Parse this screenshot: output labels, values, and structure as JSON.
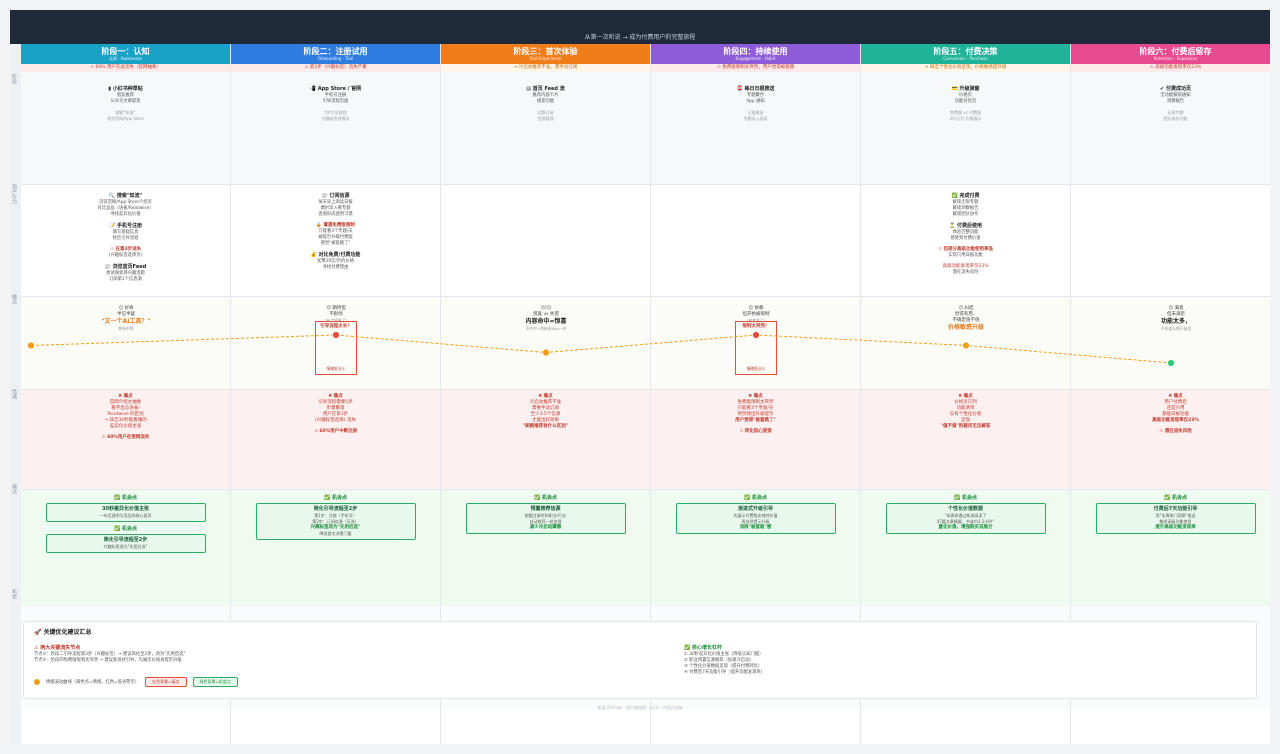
{
  "subtitle": "从第一次听说 → 成为付费用户的完整旅程",
  "gutter": [
    "阶段",
    "用户行为",
    "触点",
    "情绪",
    "痛点",
    "机会"
  ],
  "stages": [
    {
      "title": "阶段一：认知",
      "sub": "认知 · Awareness",
      "color": "#17a2c6",
      "warn": "⚠ 60% 用户在此流失（官网抽象）",
      "warn_bg": "#fdeaea",
      "touch": {
        "h": "▮ 小红书种草帖",
        "items": [
          "朋友推荐",
          "公众号文章提及"
        ],
        "grey": [
          "搜索\"知流\"",
          "浏览官网/App Store"
        ]
      },
      "actions": [
        {
          "h": "🔍 搜索\"知流\"",
          "items": [
            "浏览官网/App Store介绍页",
            "对比竞品（语雀/Readwise）",
            "寻找差异化价值"
          ]
        },
        {
          "h": "📝 手机号注册",
          "items": [
            "填写基础信息",
            "经历引导流程"
          ]
        },
        {
          "r": "⚠ 在第3步流失",
          "items": [
            "(兴趣标签选择页)"
          ]
        },
        {
          "h": "📰 浏览首页Feed",
          "items": [
            "尝试搜索感兴趣话题",
            "订阅第1个信息源"
          ]
        }
      ],
      "emotion": {
        "emo": "😐 好奇",
        "sub": "半信半疑",
        "quote": "\"又一个AI工具？\"",
        "small": "期待中等"
      },
      "pain": {
        "h": "✖ 痛点",
        "items": [
          "官网介绍太抽象",
          "看不出与语雀/",
          "Readwise 的区别",
          "→ 缺乏30秒能看懂的",
          "差异化价值主张"
        ],
        "stat": "⚠ 60%用户在官网流失"
      },
      "opps": [
        {
          "t": "30秒差异化价值主张",
          "s": "一句话说明与竞品的核心差异"
        },
        {
          "t": "简化引导流程至2步",
          "s": "兴趣标签改为\"先用后选\""
        }
      ]
    },
    {
      "title": "阶段二：注册试用",
      "sub": "Onboarding · Trial",
      "color": "#2f7de1",
      "warn": "⚠ 第3步（兴趣标签）流失严重",
      "warn_bg": "#fdeaea",
      "touch": {
        "h": "📲 App Store / 官网",
        "items": [
          "手机号注册",
          "引导流程页面"
        ],
        "grey": [
          "5步引导流程",
          "兴趣标签选择页"
        ]
      },
      "actions": [
        {
          "h": "📰 订阅信源",
          "items": [
            "每天早上阅读日报",
            "偶尔深入看专题",
            "逐渐形成使用习惯"
          ]
        },
        {
          "r": "🔒 遭遇免费版限制",
          "items": [
            "只能看3个专题/天",
            "被提示升级付费版",
            "感觉\"被套路了\""
          ]
        },
        {
          "h": "💰 对比免费/付费功能",
          "items": [
            "犹豫29元/月的价格",
            "寻找付费理由"
          ]
        }
      ],
      "emotion": {
        "emo": "😊 期待但",
        "sub": "不耐烦",
        "box": "引导流程太长！",
        "box_sub": "情绪低谷①",
        "small": "\"有点疲惫了\""
      },
      "pain": {
        "h": "✖ 痛点",
        "items": [
          "引导流程需要5步",
          "步骤繁琐",
          "用户在第3步",
          "(兴趣标签选择) 流失"
        ],
        "stat": "⚠ 60%用户中断注册"
      },
      "opps": [
        {
          "t": "简化引导流程至2步",
          "s": "第1步：注册（手机号）",
          "s2": "第2步：订阅信源（可选）",
          "g": "兴趣标签改为\"先用后选\"",
          "g2": "降低首次决策门槛"
        }
      ]
    },
    {
      "title": "阶段三：首次体验",
      "sub": "First Experience",
      "color": "#f07d1a",
      "warn": "→ 冷启动推荐不准，需手动订阅",
      "warn_bg": "#fff6ea",
      "touch": {
        "h": "▤ 首页 Feed 流",
        "items": [
          "推荐内容卡片",
          "搜索功能"
        ],
        "grey": [
          "话题订阅",
          "信源管理"
        ]
      },
      "actions": [],
      "emotion": {
        "emo": "😕/😐",
        "sub": "惊喜 vs 失望",
        "big": "内容命中=惊喜",
        "small": "不命中=和新闻App一样"
      },
      "pain": {
        "h": "✖ 痛点",
        "items": [
          "冷启动推荐不准",
          "需要手动订阅",
          "至少3-5个信源",
          "才能出好效果"
        ],
        "red": "\"刷刷推荐有什么区别\""
      },
      "opps": [
        {
          "t": "预置推荐信源",
          "s": "根据注册时的职业/行业",
          "s2": "自动推荐一组信源",
          "g": "减少冷启动摩擦"
        }
      ]
    },
    {
      "title": "阶段四：持续使用",
      "sub": "Engagement · Habit",
      "color": "#8e5bd9",
      "warn": "⚠ 免费版限制太突然，用户觉得被套路",
      "warn_bg": "#fdeaea",
      "touch": {
        "h": "📮 每日日报推送",
        "items": [
          "专题聚合",
          "App 通知"
        ],
        "grey": [
          "日报推送",
          "专题深入阅读"
        ]
      },
      "actions": [],
      "emotion": {
        "emo": "😊 依赖",
        "sub": "但开始被限制",
        "box": "限制太突然！",
        "box_sub": "情绪低谷②",
        "small": "\"被套路了\""
      },
      "pain": {
        "h": "✖ 痛点",
        "items": [
          "免费版限制太突然",
          "只能看3个专题/天",
          "突然弹出升级提示"
        ],
        "red": "用户觉得\"被套路了\"",
        "stat": "⚠ 转化信心受损"
      },
      "opps": [
        {
          "t": "渐进式升级引导",
          "s": "先展示付费版本独特价值",
          "s2": "再自然提示升级",
          "g": "消除\"被套路\"感"
        }
      ]
    },
    {
      "title": "阶段五：付费决策",
      "sub": "Conversion · Purchase",
      "color": "#1fb39a",
      "warn": "→ 缺乏个性化价值呈现，价格敏感度升级",
      "warn_bg": "#fff6ea",
      "touch": {
        "h": "💳 升级弹窗",
        "items": [
          "价格页",
          "功能对比页"
        ],
        "grey": [
          "免费版 vs 付费版",
          "29元/月 价格展示"
        ]
      },
      "actions": [
        {
          "h": "✅ 完成付费",
          "items": [
            "解锁无限专题",
            "解锁洞察报告",
            "解锁团队协作"
          ]
        },
        {
          "h": "⏳ 付费后使用",
          "items": [
            "体验完整功能",
            "感受到付费价值"
          ]
        },
        {
          "r": "⚠ 但部分高级功能使用率低",
          "items": [
            "实际只用日报功能"
          ]
        },
        {
          "g": "高级功能发现率仅23%",
          "items": [
            "潜在流失风险"
          ]
        }
      ],
      "emotion": {
        "emo": "😐 纠结",
        "sub": "觉得有用，",
        "sub2": "不确定值不值",
        "quote": "价格敏感升级",
        "small": ""
      },
      "pain": {
        "h": "✖ 痛点",
        "items": [
          "价格页只列",
          "功能清单",
          "没有个性化价值",
          "呈现"
        ],
        "red": "\"值不值\"的疑问无法解答"
      },
      "opps": [
        {
          "t": "个性化价值数据",
          "s": "\"本周你通过知流阅读了",
          "s2": "47篇文章摘要，节省约3.5小时\"",
          "g": "量化价值，增强购买说服力"
        }
      ]
    },
    {
      "title": "阶段六：付费后留存",
      "sub": "Retention · Expansion",
      "color": "#e84a8f",
      "warn": "⚠ 高级功能发现率仅23%",
      "warn_bg": "#fdeaea",
      "touch": {
        "h": "✔ 付费成功页",
        "items": [
          "全功能解锁通知",
          "洞察报告"
        ],
        "grey": [
          "无限专题",
          "团队协作功能"
        ]
      },
      "actions": [],
      "emotion": {
        "emo": "😊 满意",
        "sub": "但未满足",
        "big": "功能太多，",
        "small": "不知道从哪开始用"
      },
      "pain": {
        "h": "✖ 痛点",
        "items": [
          "用户付费后",
          "还是只用",
          "基础日报功能"
        ],
        "red": "高级功能发现率仅23%",
        "stat": "⚠ 潜在流失风险"
      },
      "opps": [
        {
          "t": "付费后7天功能引导",
          "s": "用\"本周热门洞察\"推送",
          "s2": "触发高级功能使用",
          "g": "提升高级功能发现率"
        }
      ]
    }
  ],
  "opp_head": "✅ 机会点",
  "summary": {
    "title": "🚀 关键优化建议汇总",
    "left_h": "⚠ 两大关键流失节点",
    "left": [
      "节点①：阶段二引导流程第3步（兴趣标签）→ 建议简化至2步，改为\"先用后选\"",
      "节点②：阶段四免费版限制太突然 → 建议渐进式引导，先展示价值再提示升级"
    ],
    "right_h": "✅ 核心增长杠杆",
    "right": [
      "① 30秒差异化价值主张（降低认知门槛）",
      "② 职业预置信源推荐（加速冷启动）",
      "③ 个性化价值数据呈现（提升付费转化）",
      "④ 付费后7天功能引导（提升功能发现率）"
    ],
    "legend": "情绪波动曲线（黄色点=情绪，红色=低谷警示）",
    "legend_red": "红色背景=痛点",
    "legend_green": "绿色背景=机会点"
  },
  "footer": "知流 ZhiFlow · 用户旅程图 · v2.0 · 内部讨论稿",
  "emotion_levels": [
    0.45,
    0.6,
    0.35,
    0.6,
    0.45,
    0.2
  ]
}
